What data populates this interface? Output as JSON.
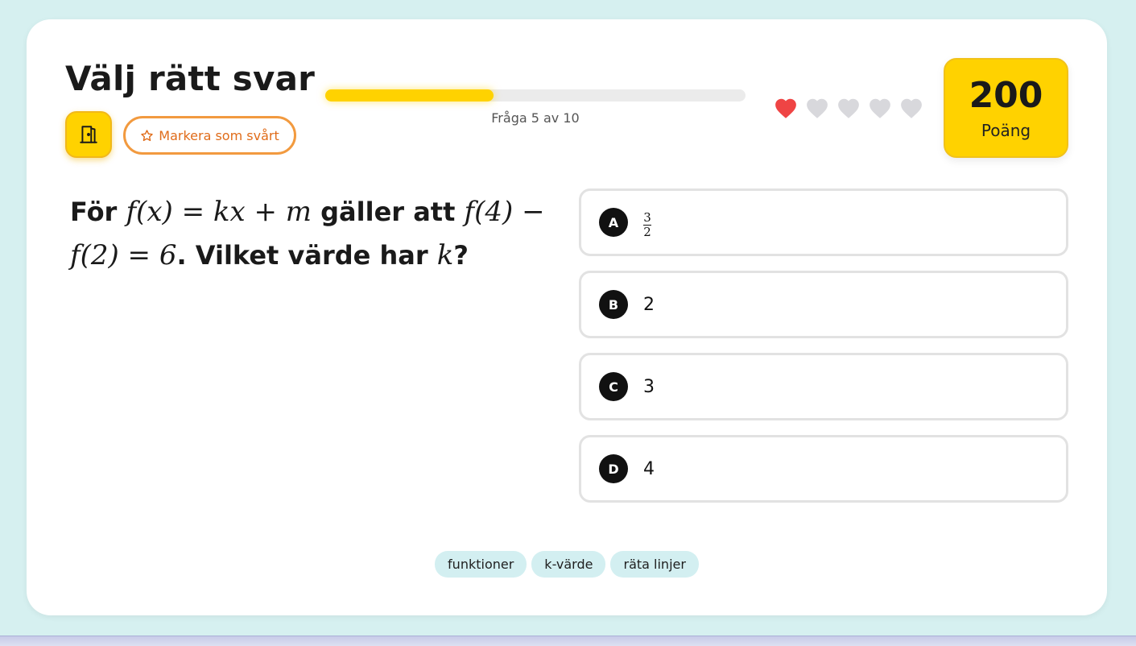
{
  "header": {
    "title": "Välj rätt svar",
    "mark_label": "Markera som svårt"
  },
  "progress": {
    "current": 5,
    "total": 10,
    "fraction": 0.4,
    "label": "Fråga 5 av 10"
  },
  "lives": {
    "total": 5,
    "remaining": 1,
    "active_color": "#ef4444",
    "inactive_color": "#d8d8dc"
  },
  "score": {
    "value": "200",
    "label": "Poäng"
  },
  "question": {
    "lead": "För",
    "math1": "f(x) = kx + m",
    "mid": "gäller att",
    "math2": "f(4) − f(2) = 6",
    "tail": ". Vilket värde har",
    "math3": "k",
    "end": "?"
  },
  "answers": [
    {
      "letter": "A",
      "numerator": "3",
      "denominator": "2"
    },
    {
      "letter": "B",
      "text": "2"
    },
    {
      "letter": "C",
      "text": "3"
    },
    {
      "letter": "D",
      "text": "4"
    }
  ],
  "tags": [
    "funktioner",
    "k-värde",
    "räta linjer"
  ],
  "colors": {
    "accent": "#ffd200",
    "mark_border": "#f29a3f",
    "background": "#d6f0f0"
  },
  "icons": {
    "exit": "door-exit-icon",
    "mark": "star-outline-icon",
    "life": "heart-icon"
  }
}
